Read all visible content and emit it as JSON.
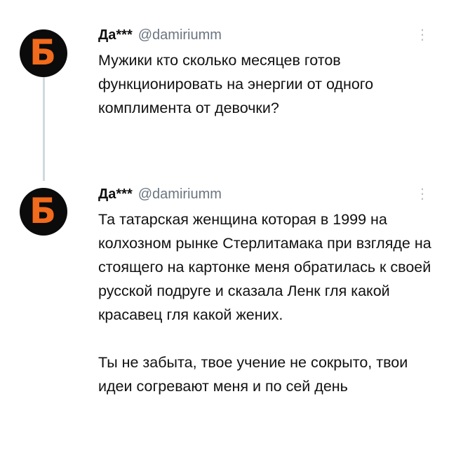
{
  "tweets": [
    {
      "avatar_letter": "Б",
      "author_name": "Да***",
      "author_handle": "@damiriumm",
      "paragraphs": [
        "Мужики кто сколько месяцев готов функционировать на энергии от одного комплимента от девочки?"
      ]
    },
    {
      "avatar_letter": "Б",
      "author_name": "Да***",
      "author_handle": "@damiriumm",
      "paragraphs": [
        "Та татарская женщина которая в 1999 на колхозном рынке Стерлитамака при взгляде на стоящего на картонке меня обратилась к своей русской подруге и сказала Ленк гля какой красавец гля какой жених.",
        "Ты не забыта, твое учение не сокрыто, твои идеи согревают меня и по сей день"
      ]
    }
  ],
  "colors": {
    "avatar_bg": "#0b0b0b",
    "avatar_letter": "#f26a1b",
    "handle": "#6b7580",
    "thread_line": "#cfd9de"
  }
}
